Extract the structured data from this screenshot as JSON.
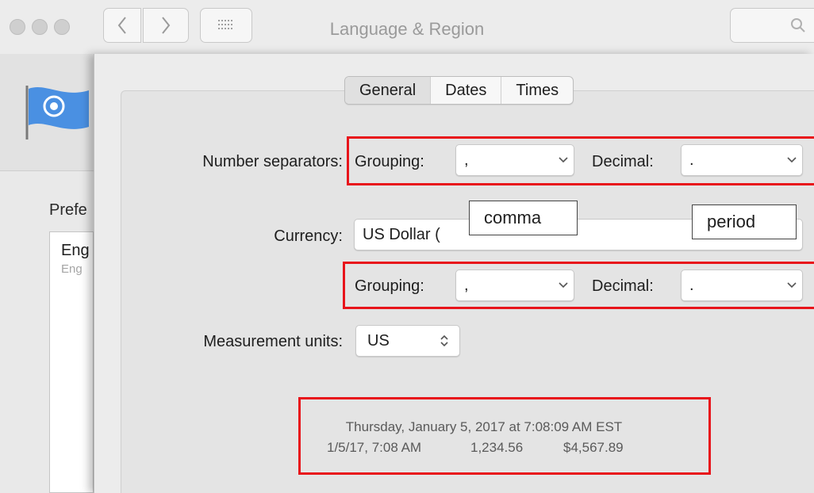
{
  "window": {
    "title": "Language & Region",
    "icons": {
      "back": "chevron-left-icon",
      "forward": "chevron-right-icon",
      "show_all": "grid-icon",
      "search": "search-icon"
    }
  },
  "sidebar": {
    "preferred_languages_label": "Prefe",
    "languages": [
      {
        "name": "Eng",
        "sub": "Eng"
      }
    ]
  },
  "tabs": [
    {
      "label": "General",
      "active": true
    },
    {
      "label": "Dates",
      "active": false
    },
    {
      "label": "Times",
      "active": false
    }
  ],
  "number_separators": {
    "label": "Number separators:",
    "grouping_label": "Grouping:",
    "grouping_value": ",",
    "decimal_label": "Decimal:",
    "decimal_value": "."
  },
  "currency": {
    "label": "Currency:",
    "value": "US Dollar (",
    "grouping_label": "Grouping:",
    "grouping_value": ",",
    "decimal_label": "Decimal:",
    "decimal_value": "."
  },
  "measurement": {
    "label": "Measurement units:",
    "value": "US"
  },
  "annotations": {
    "comma": "comma",
    "period": "period",
    "highlight_color": "#e8141b"
  },
  "sample": {
    "line1": "Thursday, January 5, 2017 at 7:08:09 AM EST",
    "date_short": "1/5/17, 7:08 AM",
    "number": "1,234.56",
    "currency": "$4,567.89"
  }
}
